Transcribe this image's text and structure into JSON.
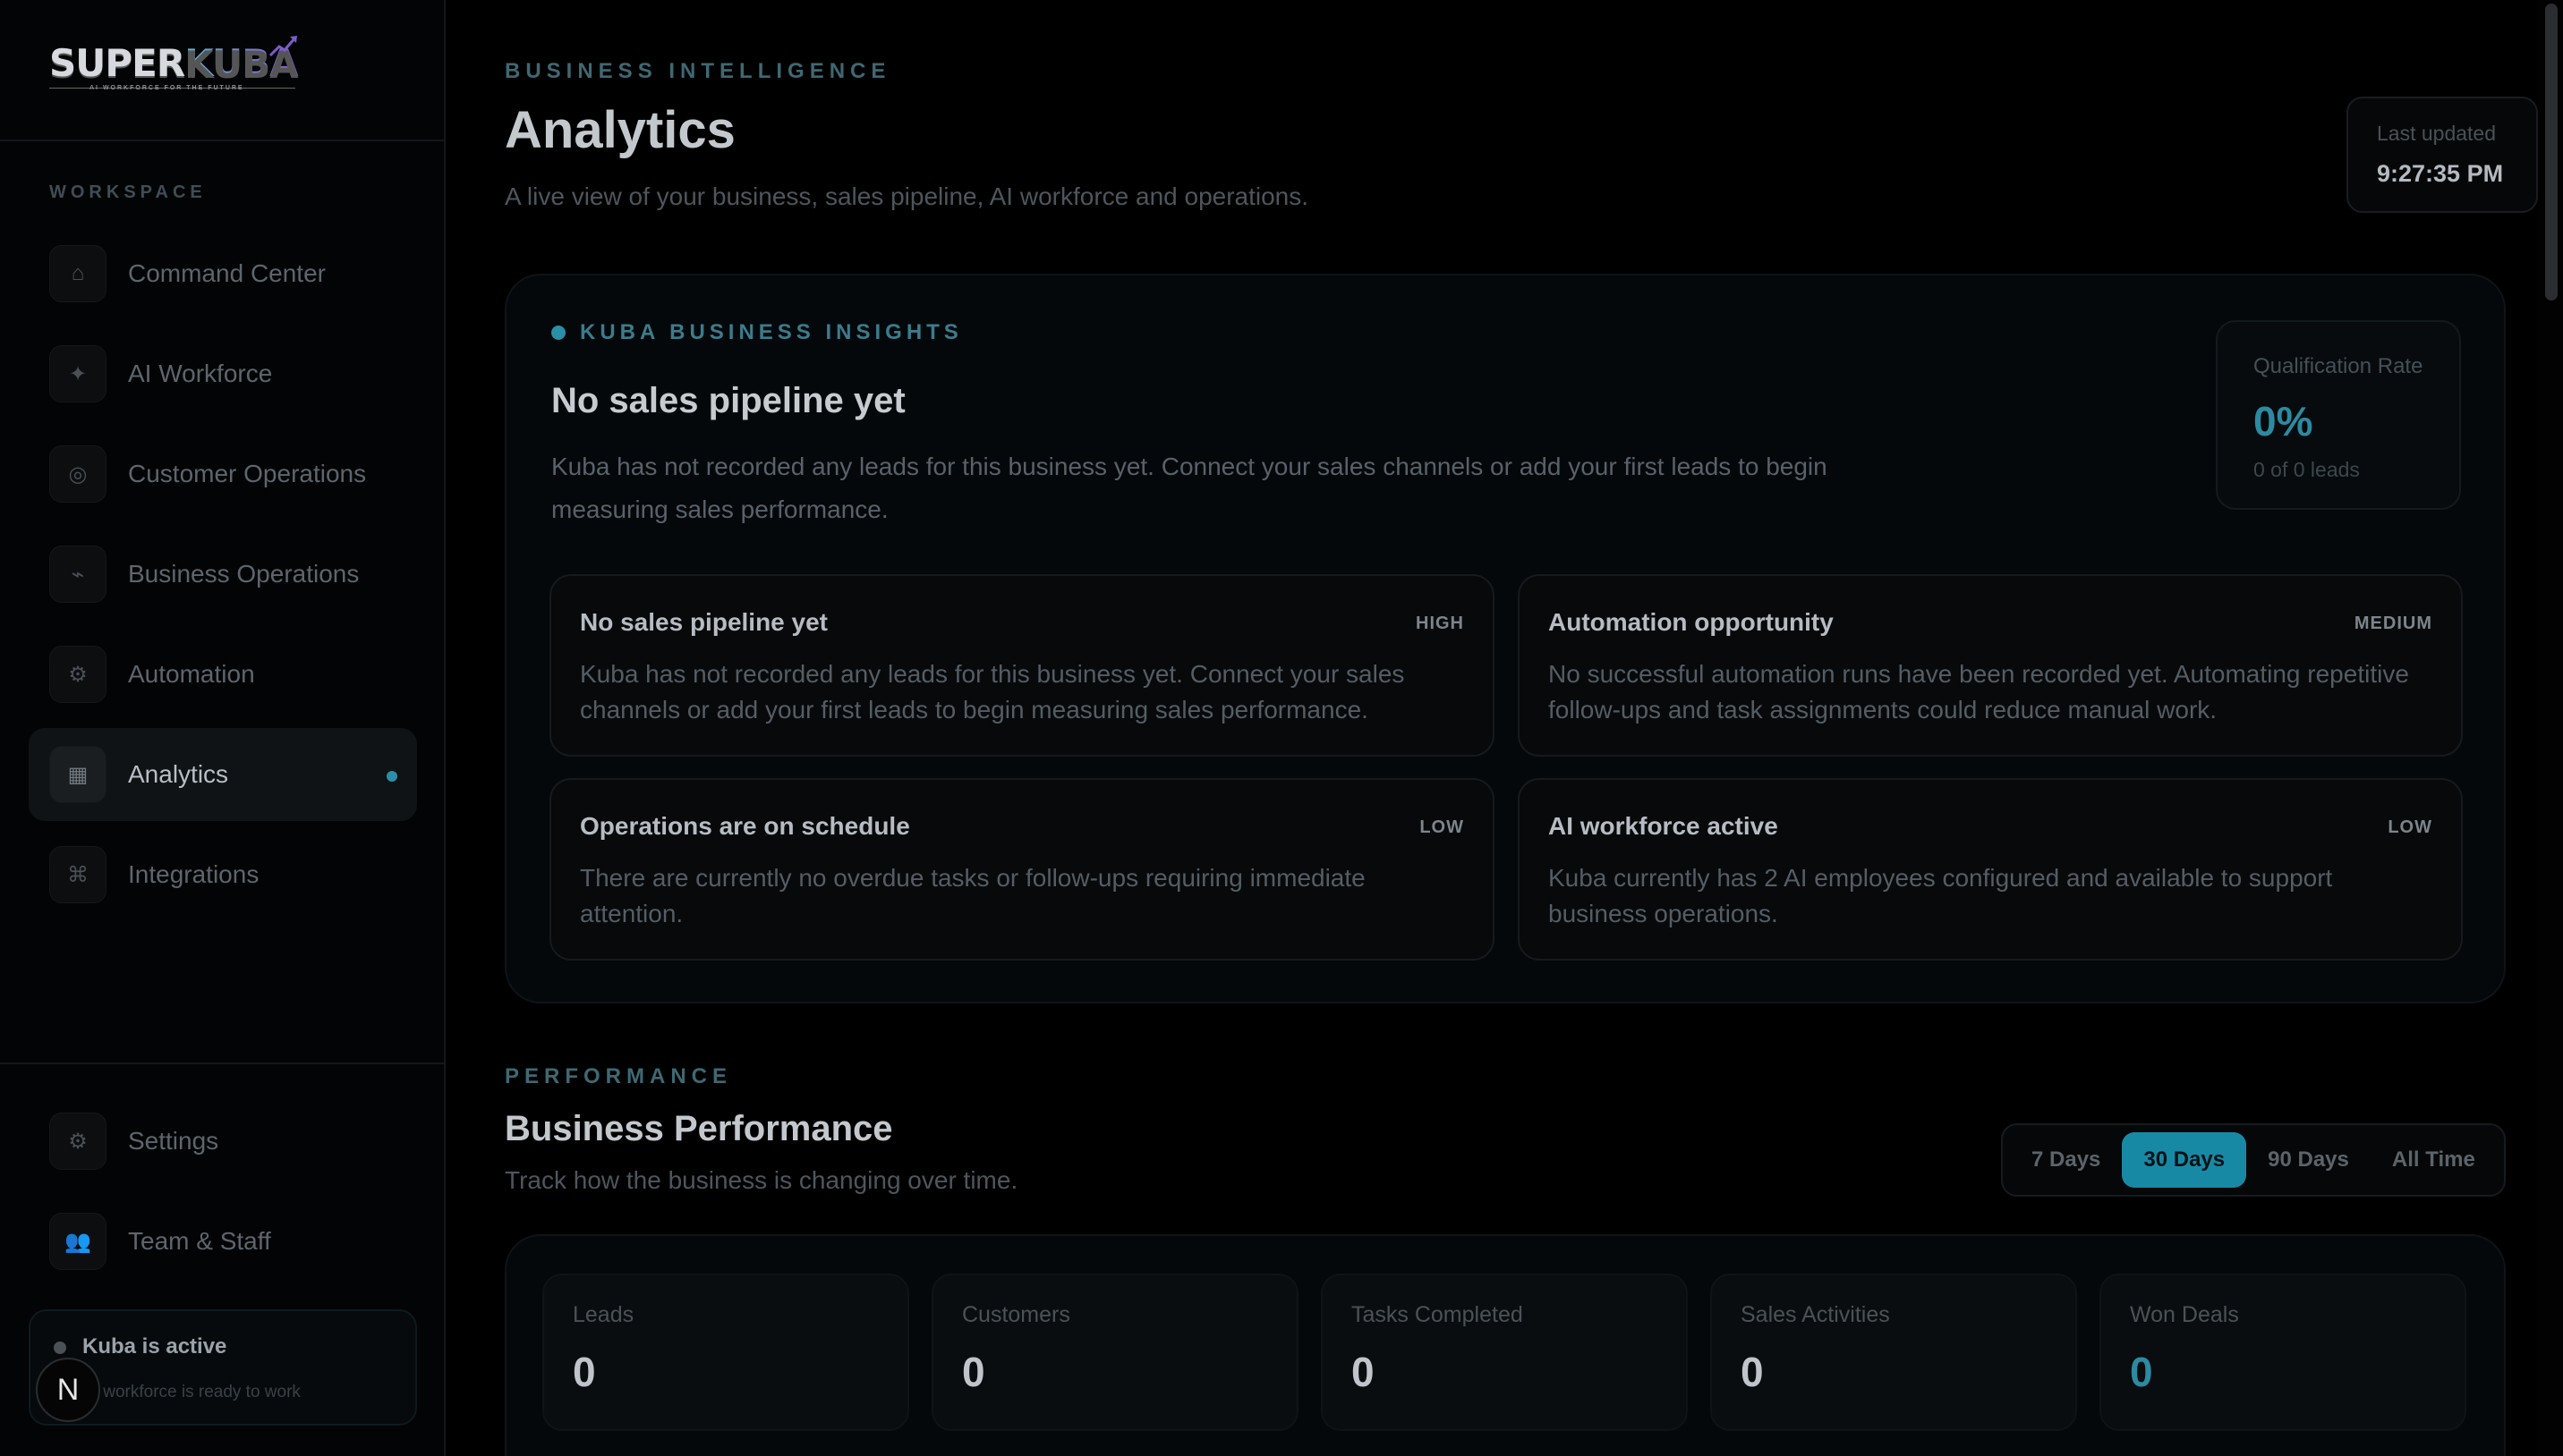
{
  "brand": {
    "name_prefix": "SUPER",
    "name_suffix": "KUBA",
    "tagline": "AI WORKFORCE FOR THE FUTURE"
  },
  "sidebar": {
    "section_label": "WORKSPACE",
    "items": [
      {
        "label": "Command Center",
        "icon": "home-icon",
        "glyph": "⌂"
      },
      {
        "label": "AI Workforce",
        "icon": "sparkle-icon",
        "glyph": "✦"
      },
      {
        "label": "Customer Operations",
        "icon": "target-icon",
        "glyph": "◎"
      },
      {
        "label": "Business Operations",
        "icon": "pulse-icon",
        "glyph": "⌁"
      },
      {
        "label": "Automation",
        "icon": "gear-icon",
        "glyph": "⚙"
      },
      {
        "label": "Analytics",
        "icon": "chart-icon",
        "glyph": "▦"
      },
      {
        "label": "Integrations",
        "icon": "command-icon",
        "glyph": "⌘"
      }
    ],
    "bottom_items": [
      {
        "label": "Settings",
        "icon": "settings-icon",
        "glyph": "⚙"
      },
      {
        "label": "Team & Staff",
        "icon": "people-icon",
        "glyph": "👥"
      }
    ],
    "status": {
      "title": "Kuba is active",
      "subtitle": "AI workforce is ready to work"
    },
    "badge_letter": "N"
  },
  "header": {
    "eyebrow": "BUSINESS INTELLIGENCE",
    "title": "Analytics",
    "subtitle": "A live view of your business, sales pipeline, AI workforce and operations.",
    "last_updated_label": "Last updated",
    "last_updated_time": "9:27:35 PM"
  },
  "insights": {
    "eyebrow": "KUBA BUSINESS INSIGHTS",
    "title": "No sales pipeline yet",
    "description": "Kuba has not recorded any leads for this business yet. Connect your sales channels or add your first leads to begin measuring sales performance.",
    "qualification": {
      "label": "Qualification Rate",
      "value": "0%",
      "sub": "0 of 0 leads"
    },
    "cards": [
      {
        "title": "No sales pipeline yet",
        "level": "HIGH",
        "body": "Kuba has not recorded any leads for this business yet. Connect your sales channels or add your first leads to begin measuring sales performance."
      },
      {
        "title": "Automation opportunity",
        "level": "MEDIUM",
        "body": "No successful automation runs have been recorded yet. Automating repetitive follow-ups and task assignments could reduce manual work."
      },
      {
        "title": "Operations are on schedule",
        "level": "LOW",
        "body": "There are currently no overdue tasks or follow-ups requiring immediate attention."
      },
      {
        "title": "AI workforce active",
        "level": "LOW",
        "body": "Kuba currently has 2 AI employees configured and available to support business operations."
      }
    ]
  },
  "performance": {
    "eyebrow": "PERFORMANCE",
    "title": "Business Performance",
    "subtitle": "Track how the business is changing over time.",
    "ranges": [
      "7 Days",
      "30 Days",
      "90 Days",
      "All Time"
    ],
    "active_range": "30 Days",
    "metrics": [
      {
        "label": "Leads",
        "value": "0"
      },
      {
        "label": "Customers",
        "value": "0"
      },
      {
        "label": "Tasks Completed",
        "value": "0"
      },
      {
        "label": "Sales Activities",
        "value": "0"
      },
      {
        "label": "Won Deals",
        "value": "0"
      }
    ]
  },
  "colors": {
    "accent": "#1889a5",
    "background": "#000000"
  }
}
